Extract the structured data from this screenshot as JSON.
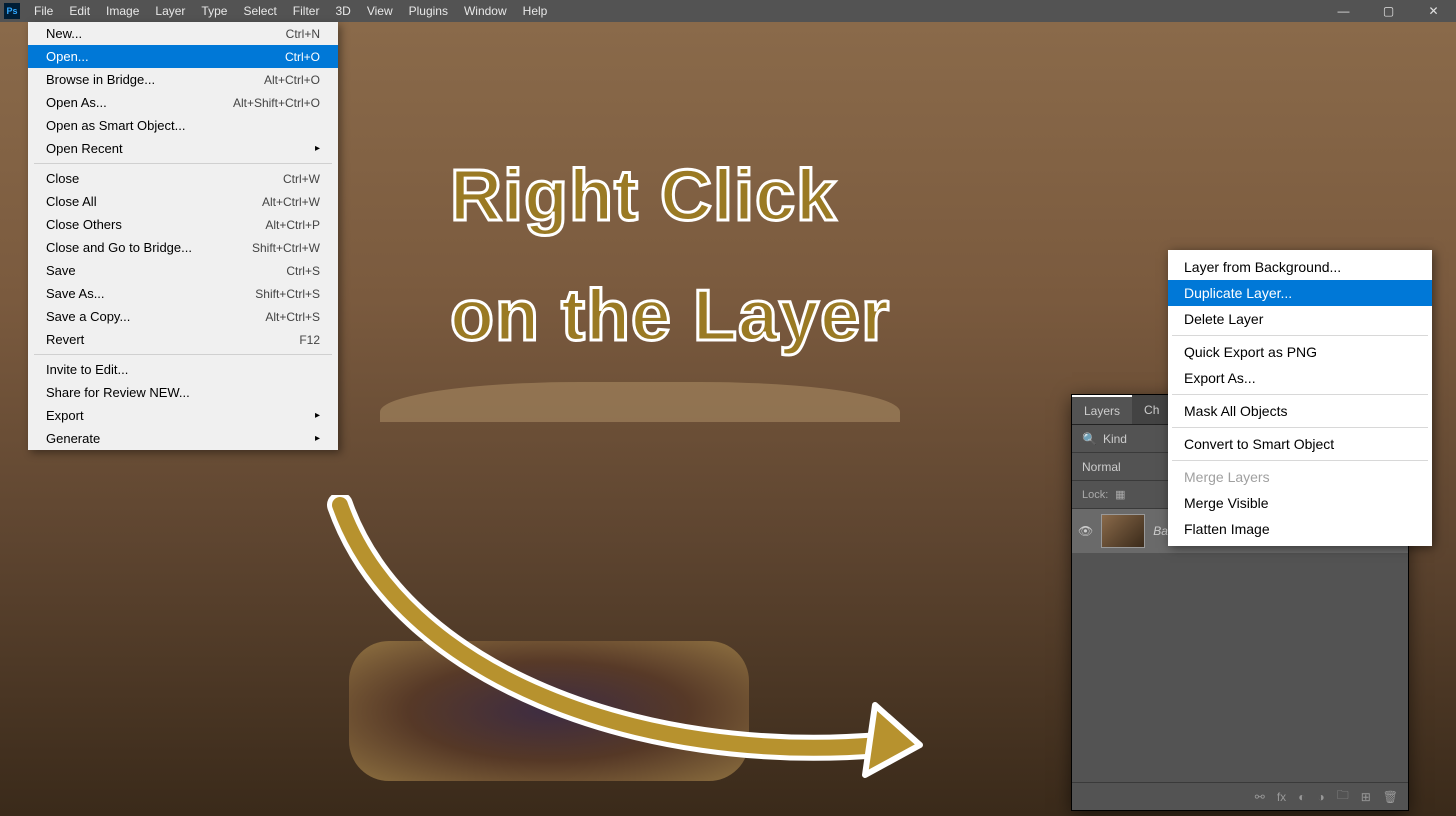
{
  "app": {
    "logo": "Ps"
  },
  "menubar": [
    "File",
    "Edit",
    "Image",
    "Layer",
    "Type",
    "Select",
    "Filter",
    "3D",
    "View",
    "Plugins",
    "Window",
    "Help"
  ],
  "file_menu": {
    "groups": [
      [
        {
          "label": "New...",
          "shortcut": "Ctrl+N"
        },
        {
          "label": "Open...",
          "shortcut": "Ctrl+O",
          "highlighted": true
        },
        {
          "label": "Browse in Bridge...",
          "shortcut": "Alt+Ctrl+O"
        },
        {
          "label": "Open As...",
          "shortcut": "Alt+Shift+Ctrl+O"
        },
        {
          "label": "Open as Smart Object..."
        },
        {
          "label": "Open Recent",
          "submenu": true
        }
      ],
      [
        {
          "label": "Close",
          "shortcut": "Ctrl+W"
        },
        {
          "label": "Close All",
          "shortcut": "Alt+Ctrl+W"
        },
        {
          "label": "Close Others",
          "shortcut": "Alt+Ctrl+P"
        },
        {
          "label": "Close and Go to Bridge...",
          "shortcut": "Shift+Ctrl+W"
        },
        {
          "label": "Save",
          "shortcut": "Ctrl+S"
        },
        {
          "label": "Save As...",
          "shortcut": "Shift+Ctrl+S"
        },
        {
          "label": "Save a Copy...",
          "shortcut": "Alt+Ctrl+S"
        },
        {
          "label": "Revert",
          "shortcut": "F12"
        }
      ],
      [
        {
          "label": "Invite to Edit..."
        },
        {
          "label": "Share for Review NEW..."
        },
        {
          "label": "Export",
          "submenu": true
        },
        {
          "label": "Generate",
          "submenu": true
        }
      ]
    ]
  },
  "annotation": {
    "line1": "Right Click",
    "line2": "on the Layer"
  },
  "layers_panel": {
    "tabs": [
      "Layers",
      "Ch"
    ],
    "search_label": "Kind",
    "blend_mode": "Normal",
    "lock_label": "Lock:",
    "layer": {
      "name": "Background"
    }
  },
  "context_menu": {
    "groups": [
      [
        {
          "label": "Layer from Background..."
        },
        {
          "label": "Duplicate Layer...",
          "highlighted": true
        },
        {
          "label": "Delete Layer"
        }
      ],
      [
        {
          "label": "Quick Export as PNG"
        },
        {
          "label": "Export As..."
        }
      ],
      [
        {
          "label": "Mask All Objects"
        }
      ],
      [
        {
          "label": "Convert to Smart Object"
        }
      ],
      [
        {
          "label": "Merge Layers",
          "disabled": true
        },
        {
          "label": "Merge Visible"
        },
        {
          "label": "Flatten Image"
        }
      ]
    ]
  }
}
